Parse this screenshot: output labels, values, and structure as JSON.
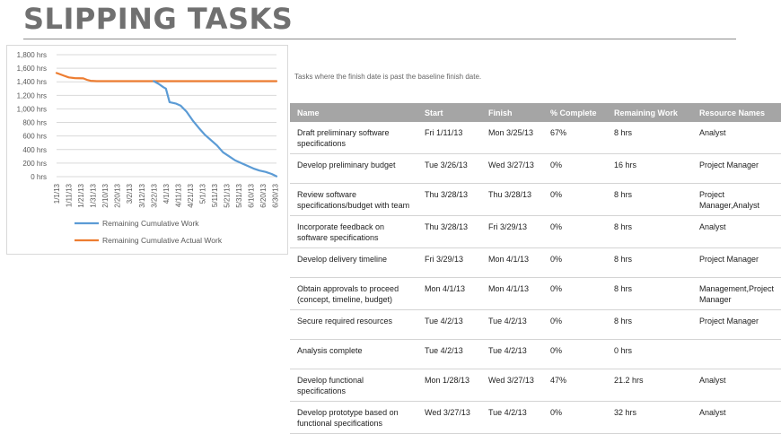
{
  "page": {
    "title": "SLIPPING TASKS",
    "subtitle": "Tasks where the finish date is past the baseline finish date."
  },
  "chart_data": {
    "type": "line",
    "x": [
      "1/1/13",
      "1/11/13",
      "1/21/13",
      "1/31/13",
      "2/10/13",
      "2/20/13",
      "3/2/13",
      "3/12/13",
      "3/22/13",
      "4/1/13",
      "4/11/13",
      "4/21/13",
      "5/1/13",
      "5/11/13",
      "5/21/13",
      "5/31/13",
      "6/10/13",
      "6/20/13",
      "6/30/13"
    ],
    "x_ticks": [
      "1/1/13",
      "1/11/13",
      "1/21/13",
      "1/31/13",
      "2/10/13",
      "2/20/13",
      "3/2/13",
      "3/12/13",
      "3/22/13",
      "4/1/13",
      "4/11/13",
      "4/21/13",
      "5/1/13",
      "5/11/13",
      "5/21/13",
      "5/31/13",
      "6/10/13",
      "6/20/13",
      "6/30/13"
    ],
    "y_ticks": [
      "1,800 hrs",
      "1,600 hrs",
      "1,400 hrs",
      "1,200 hrs",
      "1,000 hrs",
      "800 hrs",
      "600 hrs",
      "400 hrs",
      "200 hrs",
      "0 hrs"
    ],
    "ylim": [
      0,
      1800
    ],
    "grid": true,
    "legend_position": "bottom",
    "series": [
      {
        "name": "Remaining Cumulative Work",
        "color": "#5b9bd5",
        "points": [
          [
            "3/22/13",
            1410
          ],
          [
            "3/26/13",
            1370
          ],
          [
            "3/30/13",
            1320
          ],
          [
            "4/1/13",
            1300
          ],
          [
            "4/4/13",
            1100
          ],
          [
            "4/9/13",
            1080
          ],
          [
            "4/13/13",
            1050
          ],
          [
            "4/18/13",
            960
          ],
          [
            "4/23/13",
            830
          ],
          [
            "4/28/13",
            720
          ],
          [
            "5/3/13",
            620
          ],
          [
            "5/8/13",
            540
          ],
          [
            "5/13/13",
            460
          ],
          [
            "5/18/13",
            360
          ],
          [
            "5/23/13",
            300
          ],
          [
            "5/28/13",
            240
          ],
          [
            "6/2/13",
            200
          ],
          [
            "6/7/13",
            160
          ],
          [
            "6/12/13",
            120
          ],
          [
            "6/17/13",
            90
          ],
          [
            "6/22/13",
            70
          ],
          [
            "6/27/13",
            40
          ],
          [
            "7/1/13",
            5
          ]
        ]
      },
      {
        "name": "Remaining Cumulative Actual Work",
        "color": "#ed7d31",
        "points": [
          [
            "1/1/13",
            1530
          ],
          [
            "1/4/13",
            1510
          ],
          [
            "1/7/13",
            1490
          ],
          [
            "1/11/13",
            1465
          ],
          [
            "1/16/13",
            1455
          ],
          [
            "1/23/13",
            1450
          ],
          [
            "1/26/13",
            1430
          ],
          [
            "1/29/13",
            1415
          ],
          [
            "2/3/13",
            1410
          ],
          [
            "2/20/13",
            1410
          ],
          [
            "3/22/13",
            1410
          ],
          [
            "4/11/13",
            1410
          ],
          [
            "5/11/13",
            1410
          ],
          [
            "6/10/13",
            1410
          ],
          [
            "7/1/13",
            1410
          ]
        ]
      }
    ]
  },
  "table": {
    "headers": [
      "Name",
      "Start",
      "Finish",
      "% Complete",
      "Remaining Work",
      "Resource Names"
    ],
    "rows": [
      [
        "Draft preliminary software specifications",
        "Fri 1/11/13",
        "Mon 3/25/13",
        "67%",
        "8 hrs",
        "Analyst"
      ],
      [
        "Develop preliminary budget",
        "Tue 3/26/13",
        "Wed 3/27/13",
        "0%",
        "16 hrs",
        "Project Manager"
      ],
      [
        "Review software specifications/budget with team",
        "Thu 3/28/13",
        "Thu 3/28/13",
        "0%",
        "8 hrs",
        "Project Manager,Analyst"
      ],
      [
        "Incorporate feedback on software specifications",
        "Thu 3/28/13",
        "Fri 3/29/13",
        "0%",
        "8 hrs",
        "Analyst"
      ],
      [
        "Develop delivery timeline",
        "Fri 3/29/13",
        "Mon 4/1/13",
        "0%",
        "8 hrs",
        "Project Manager"
      ],
      [
        "Obtain approvals to proceed (concept, timeline, budget)",
        "Mon 4/1/13",
        "Mon 4/1/13",
        "0%",
        "8 hrs",
        "Management,Project Manager"
      ],
      [
        "Secure required resources",
        "Tue 4/2/13",
        "Tue 4/2/13",
        "0%",
        "8 hrs",
        "Project Manager"
      ],
      [
        "Analysis complete",
        "Tue 4/2/13",
        "Tue 4/2/13",
        "0%",
        "0 hrs",
        ""
      ],
      [
        "Develop functional specifications",
        "Mon 1/28/13",
        "Wed 3/27/13",
        "47%",
        "21.2 hrs",
        "Analyst"
      ],
      [
        "Develop prototype based on functional specifications",
        "Wed 3/27/13",
        "Tue 4/2/13",
        "0%",
        "32 hrs",
        "Analyst"
      ]
    ]
  }
}
